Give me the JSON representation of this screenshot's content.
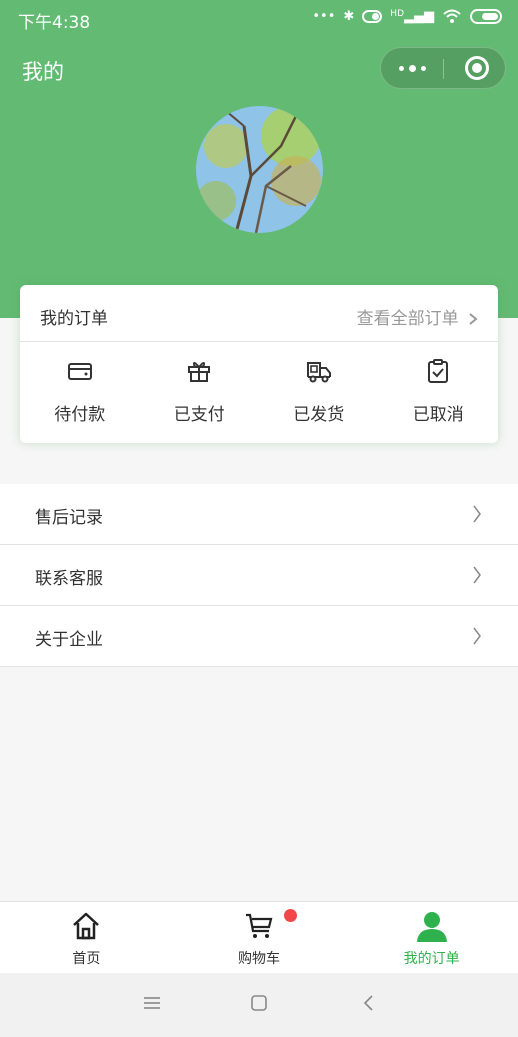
{
  "status_bar": {
    "time": "下午4:38",
    "signal_text": "HD"
  },
  "header": {
    "title": "我的"
  },
  "orders": {
    "title": "我的订单",
    "view_all": "查看全部订单",
    "items": [
      {
        "label": "待付款",
        "icon": "wallet-icon"
      },
      {
        "label": "已支付",
        "icon": "gift-icon"
      },
      {
        "label": "已发货",
        "icon": "truck-icon"
      },
      {
        "label": "已取消",
        "icon": "clipboard-check-icon"
      }
    ]
  },
  "menu": [
    {
      "label": "售后记录"
    },
    {
      "label": "联系客服"
    },
    {
      "label": "关于企业"
    }
  ],
  "tabbar": {
    "tabs": [
      {
        "label": "首页",
        "icon": "home-icon"
      },
      {
        "label": "购物车",
        "icon": "cart-icon"
      },
      {
        "label": "我的订单",
        "icon": "user-icon",
        "active": true
      }
    ]
  },
  "colors": {
    "brand_green": "#63bb73",
    "active_tab": "#2fb24e",
    "badge_red": "#f24747"
  }
}
